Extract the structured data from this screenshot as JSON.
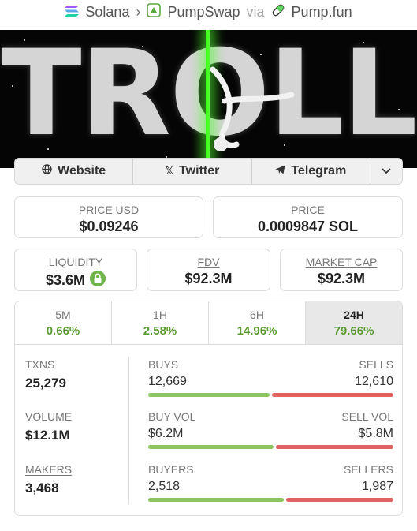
{
  "breadcrumb": {
    "chain": "Solana",
    "dex": "PumpSwap",
    "via": "via",
    "launchpad": "Pump.fun"
  },
  "banner": {
    "text": "TROLL"
  },
  "links": {
    "website": "Website",
    "twitter": "Twitter",
    "telegram": "Telegram"
  },
  "price": {
    "usd_label": "PRICE USD",
    "usd_value": "$0.09246",
    "native_label": "PRICE",
    "native_value": "0.0009847 SOL"
  },
  "metrics": {
    "liquidity_label": "LIQUIDITY",
    "liquidity_value": "$3.6M",
    "fdv_label": "FDV",
    "fdv_value": "$92.3M",
    "mcap_label": "MARKET CAP",
    "mcap_value": "$92.3M"
  },
  "timeframes": [
    {
      "label": "5M",
      "value": "0.66%"
    },
    {
      "label": "1H",
      "value": "2.58%"
    },
    {
      "label": "6H",
      "value": "14.96%"
    },
    {
      "label": "24H",
      "value": "79.66%",
      "selected": true
    }
  ],
  "stats": {
    "txns_label": "TXNS",
    "txns_value": "25,279",
    "volume_label": "VOLUME",
    "volume_value": "$12.1M",
    "makers_label": "MAKERS",
    "makers_value": "3,468",
    "buys_label": "BUYS",
    "buys_value": "12,669",
    "sells_label": "SELLS",
    "sells_value": "12,610",
    "buy_share": 0.501,
    "buyvol_label": "BUY VOL",
    "buyvol_value": "$6.2M",
    "sellvol_label": "SELL VOL",
    "sellvol_value": "$5.8M",
    "buyvol_share": 0.517,
    "buyers_label": "BUYERS",
    "buyers_value": "2,518",
    "sellers_label": "SELLERS",
    "sellers_value": "1,987",
    "buyers_share": 0.559
  },
  "colors": {
    "positive": "#5a9a2f",
    "buy_bar": "#8cc560",
    "sell_bar": "#e06262",
    "beam": "#4bff28"
  }
}
